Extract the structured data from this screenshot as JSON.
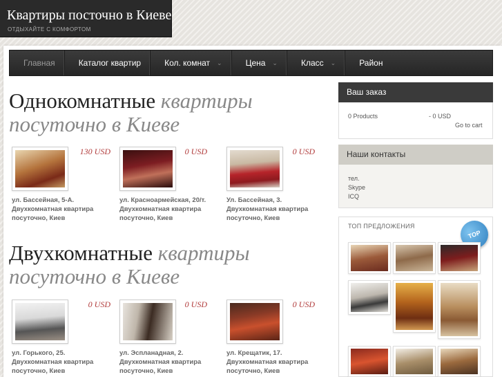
{
  "header": {
    "site_title": "Квартиры посточно в Киеве",
    "tagline": "ОТДЫХАЙТЕ С КОМФОРТОМ"
  },
  "nav": {
    "items": [
      {
        "label": "Главная",
        "dropdown": false,
        "active": true
      },
      {
        "label": "Каталог квартир",
        "dropdown": false
      },
      {
        "label": "Кол. комнат",
        "dropdown": true
      },
      {
        "label": "Цена",
        "dropdown": true
      },
      {
        "label": "Класс",
        "dropdown": true
      },
      {
        "label": "Район",
        "dropdown": false
      }
    ]
  },
  "sections": [
    {
      "title_plain": "Однокомнатные",
      "title_italic_1": "квартиры",
      "title_italic_2": "посуточно в Киеве",
      "products": [
        {
          "price": "130 USD",
          "text": "ул. Бассейная, 5-А. Двухкомнатная квартира посуточно, Киев"
        },
        {
          "price": "0 USD",
          "text": "ул. Красноармейская, 20/т. Двухкомнатная квартира посуточно, Киев"
        },
        {
          "price": "0 USD",
          "text": "Ул. Бассейная, 3. Двухкомнатная квартира посуточно, Киев"
        }
      ]
    },
    {
      "title_plain": "Двухкомнатные",
      "title_italic_1": "квартиры",
      "title_italic_2": "посуточно в Киеве",
      "products": [
        {
          "price": "0 USD",
          "text": "ул. Горького, 25. Двухкомнатная квартира посуточно, Киев"
        },
        {
          "price": "0 USD",
          "text": "ул. Эспланадная, 2. Двухкомнатная квартира посуточно, Киев"
        },
        {
          "price": "0 USD",
          "text": "ул. Крещатик, 17. Двухкомнатная квартира посуточно, Киев"
        }
      ]
    }
  ],
  "cart": {
    "title": "Ваш заказ",
    "products": "0 Products",
    "total": "-  0 USD",
    "go_to_cart": "Go to cart"
  },
  "contacts": {
    "title": "Наши контакты",
    "lines": [
      "тел.",
      "Skype",
      "ICQ"
    ]
  },
  "top_offers": {
    "title": "ТОП ПРЕДЛОЖЕНИЯ",
    "badge": "TOP"
  },
  "colors": {
    "price": "#b13b3b",
    "nav_bg": "#2e2e2e",
    "badge": "#2e7fbf"
  }
}
